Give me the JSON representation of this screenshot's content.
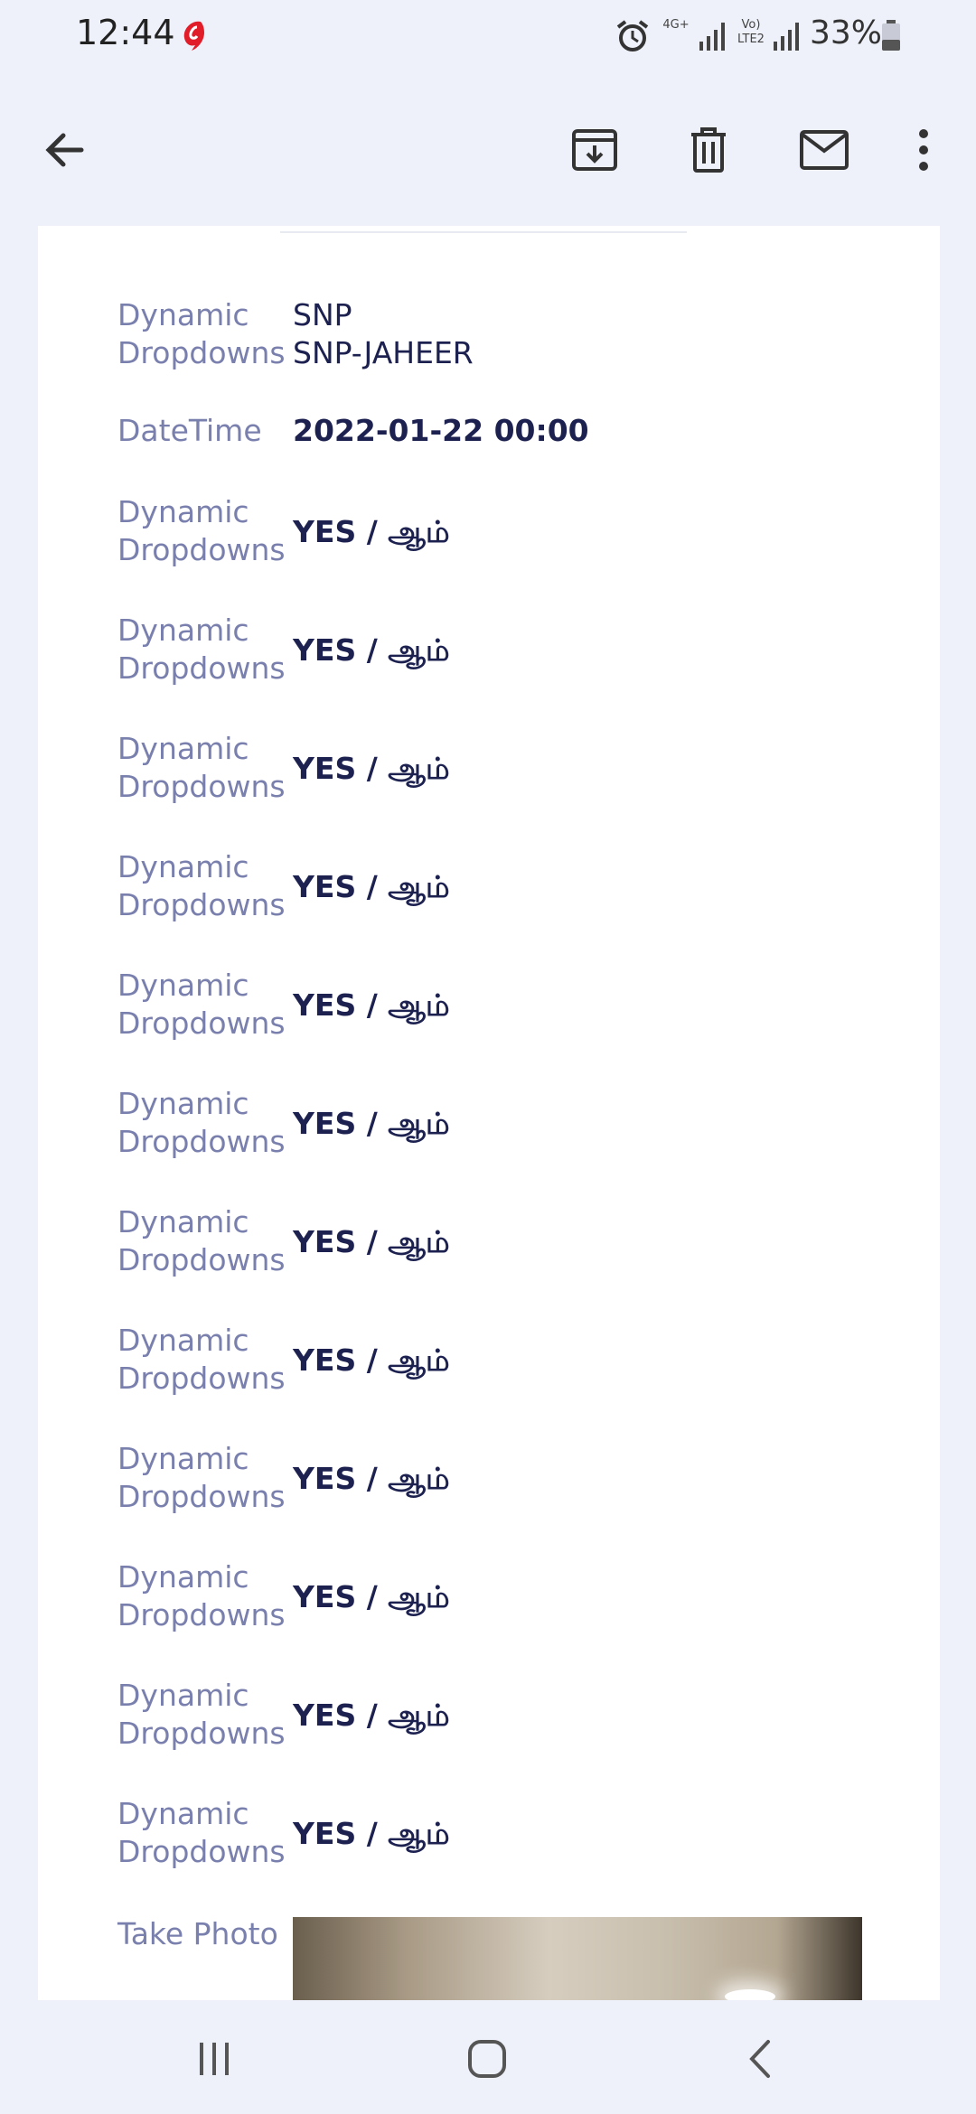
{
  "status_bar": {
    "time": "12:44",
    "network": "4G+",
    "volte": "Vo) LTE2",
    "battery": "33%"
  },
  "toolbar": {
    "icons": [
      "back-arrow-icon",
      "archive-icon",
      "delete-icon",
      "mail-icon",
      "more-icon"
    ]
  },
  "fields": [
    {
      "label": "Dynamic Dropdowns",
      "value_line1": "SNP",
      "value_line2": "SNP-JAHEER"
    },
    {
      "label": "DateTime",
      "value": "2022-01-22 00:00"
    },
    {
      "label": "Dynamic Dropdowns",
      "value": "YES / ஆம்"
    },
    {
      "label": "Dynamic Dropdowns",
      "value": "YES / ஆம்"
    },
    {
      "label": "Dynamic Dropdowns",
      "value": "YES / ஆம்"
    },
    {
      "label": "Dynamic Dropdowns",
      "value": "YES / ஆம்"
    },
    {
      "label": "Dynamic Dropdowns",
      "value": "YES / ஆம்"
    },
    {
      "label": "Dynamic Dropdowns",
      "value": "YES / ஆம்"
    },
    {
      "label": "Dynamic Dropdowns",
      "value": "YES / ஆம்"
    },
    {
      "label": "Dynamic Dropdowns",
      "value": "YES / ஆம்"
    },
    {
      "label": "Dynamic Dropdowns",
      "value": "YES / ஆம்"
    },
    {
      "label": "Dynamic Dropdowns",
      "value": "YES / ஆம்"
    },
    {
      "label": "Dynamic Dropdowns",
      "value": "YES / ஆம்"
    },
    {
      "label": "Dynamic Dropdowns",
      "value": "YES / ஆம்"
    },
    {
      "label": "Take Photo"
    }
  ],
  "colors": {
    "label": "#7a80ad",
    "value": "#1c2150",
    "background": "#eef1f9",
    "card": "#ffffff"
  },
  "nav": {
    "icons": [
      "recent-apps-icon",
      "home-icon",
      "back-icon"
    ]
  }
}
